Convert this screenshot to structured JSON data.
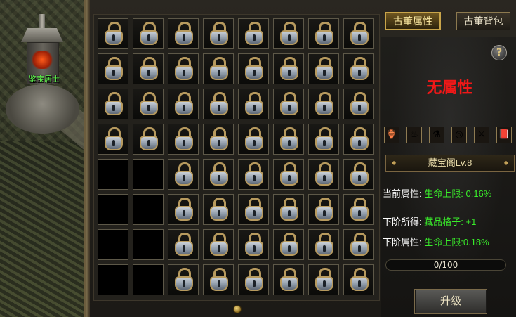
{
  "scene": {
    "npc_name": "鉴宝居士"
  },
  "grid": {
    "rows": 8,
    "cols": 8,
    "unlocked_slots": 10,
    "lock_icon": "padlock-icon"
  },
  "tabs": [
    {
      "label": "古董属性",
      "active": true
    },
    {
      "label": "古董背包",
      "active": false
    }
  ],
  "help_label": "?",
  "no_attribute_text": "无属性",
  "items": [
    {
      "icon": "bottle-icon",
      "glyph": "🏺"
    },
    {
      "icon": "crest-icon",
      "glyph": "♨"
    },
    {
      "icon": "potion-icon",
      "glyph": "⚗"
    },
    {
      "icon": "ring-icon",
      "glyph": "◎"
    },
    {
      "icon": "sword-icon",
      "glyph": "⚔"
    },
    {
      "icon": "book-icon",
      "glyph": "📕"
    }
  ],
  "level_label": "藏宝阁Lv.8",
  "current": {
    "label": "当前属性:",
    "value": "生命上限: 0.16%"
  },
  "next_gain": {
    "label": "下阶所得:",
    "value": "藏品格子: +1"
  },
  "next_attr": {
    "label": "下阶属性:",
    "value": "生命上限:0.18%"
  },
  "progress": {
    "text": "0/100",
    "current": 0,
    "max": 100
  },
  "upgrade_label": "升级",
  "colors": {
    "green": "#39ec2a",
    "red": "#f01818",
    "gold": "#c9a54a"
  }
}
